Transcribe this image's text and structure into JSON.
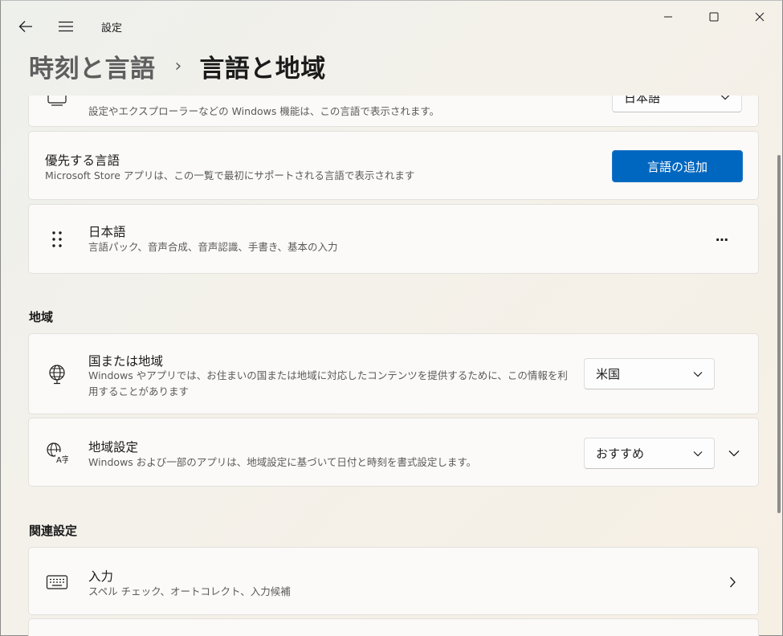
{
  "window": {
    "app_title": "設定",
    "controls": {
      "minimize": "minimize-icon",
      "maximize": "maximize-icon",
      "close": "close-icon"
    }
  },
  "header": {
    "parent": "時刻と言語",
    "separator": "›",
    "current": "言語と地域"
  },
  "windows_display_language": {
    "desc": "設定やエクスプローラーなどの Windows 機能は、この言語で表示されます。",
    "selected": "日本語"
  },
  "preferred_languages": {
    "title": "優先する言語",
    "desc": "Microsoft Store アプリは、この一覧で最初にサポートされる言語で表示されます",
    "add_button": "言語の追加",
    "items": [
      {
        "name": "日本語",
        "features": "言語パック、音声合成、音声認識、手書き、基本の入力",
        "more": "⋯"
      }
    ]
  },
  "region_section": {
    "heading": "地域",
    "country": {
      "title": "国または地域",
      "desc": "Windows やアプリでは、お住まいの国または地域に対応したコンテンツを提供するために、この情報を利用することがあります",
      "selected": "米国"
    },
    "regional_format": {
      "title": "地域設定",
      "desc": "Windows および一部のアプリは、地域設定に基づいて日付と時刻を書式設定します。",
      "selected": "おすすめ"
    }
  },
  "related_section": {
    "heading": "関連設定",
    "typing": {
      "title": "入力",
      "desc": "スペル チェック、オートコレクト、入力候補"
    }
  },
  "colors": {
    "accent": "#0067c0",
    "card": "#fbfaf8",
    "card_border": "#e3e1dc"
  }
}
